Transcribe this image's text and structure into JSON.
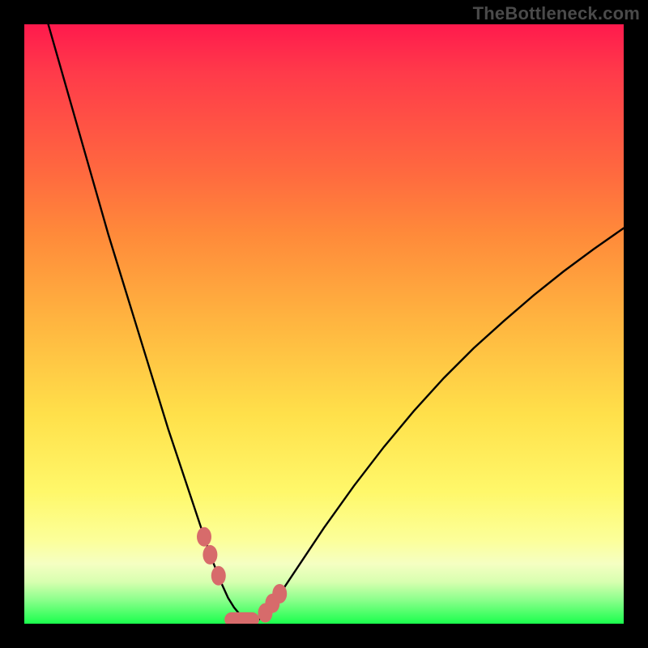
{
  "watermark": "TheBottleneck.com",
  "chart_data": {
    "type": "line",
    "title": "",
    "xlabel": "",
    "ylabel": "",
    "xlim": [
      0,
      100
    ],
    "ylim": [
      0,
      100
    ],
    "series": [
      {
        "name": "bottleneck-curve",
        "x": [
          4,
          6,
          8,
          10,
          12,
          14,
          16,
          18,
          20,
          22,
          24,
          26,
          28,
          30,
          31,
          32,
          33,
          34,
          35,
          36,
          37,
          38,
          39,
          40,
          42,
          45,
          50,
          55,
          60,
          65,
          70,
          75,
          80,
          85,
          90,
          95,
          100
        ],
        "values": [
          100,
          93,
          86,
          79,
          72,
          65,
          58.5,
          52,
          45.5,
          39,
          32.5,
          26.5,
          20.5,
          14.5,
          11.5,
          9,
          6.5,
          4.3,
          2.7,
          1.5,
          0.8,
          0.45,
          0.6,
          1.4,
          4,
          8.5,
          16,
          23,
          29.5,
          35.5,
          41,
          46,
          50.5,
          54.8,
          58.8,
          62.5,
          66
        ]
      }
    ],
    "annotations": [
      {
        "name": "marker-cluster",
        "shape": "rounded-pill",
        "color": "#d76b6b",
        "points": [
          {
            "x": 30,
            "y": 14.5
          },
          {
            "x": 31,
            "y": 11.5
          },
          {
            "x": 32.4,
            "y": 8.0
          },
          {
            "x": 40.2,
            "y": 1.8
          },
          {
            "x": 41.4,
            "y": 3.4
          },
          {
            "x": 42.6,
            "y": 5.0
          }
        ],
        "bar": {
          "x_start": 33.4,
          "x_end": 39.2,
          "y": 0.7
        }
      }
    ]
  }
}
